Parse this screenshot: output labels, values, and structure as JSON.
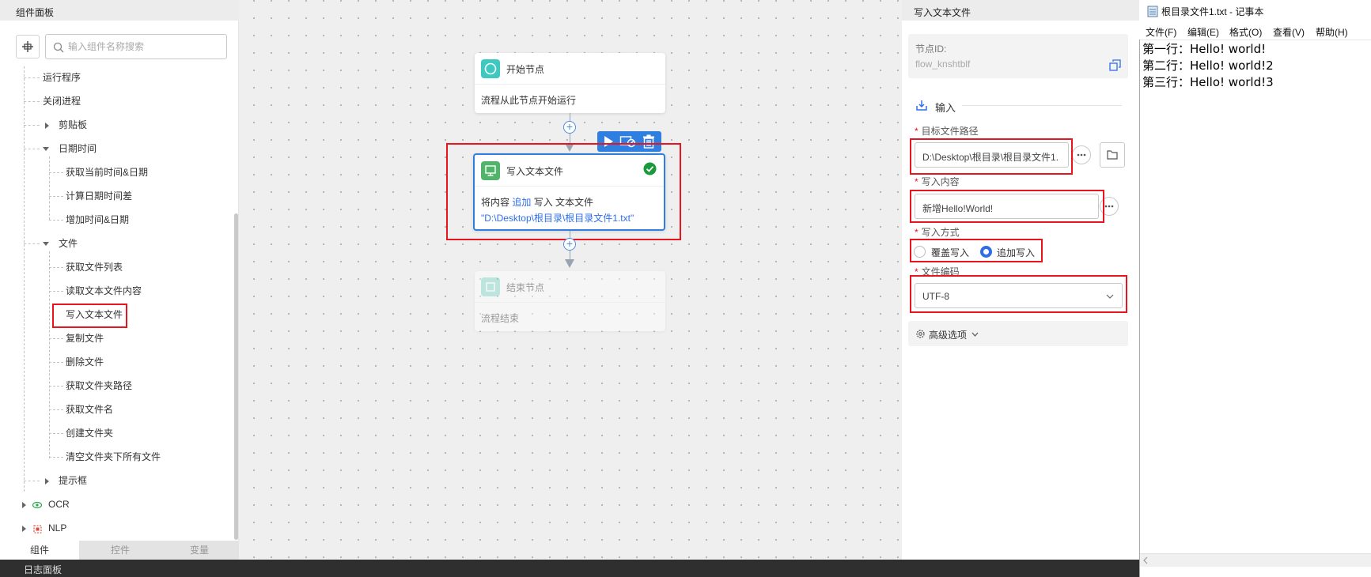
{
  "left_panel": {
    "title": "组件面板",
    "search_placeholder": "输入组件名称搜索",
    "tree": {
      "run_program": "运行程序",
      "close_process": "关闭进程",
      "clipboard": "剪贴板",
      "datetime": "日期时间",
      "get_current_datetime": "获取当前时间&日期",
      "calc_date_diff": "计算日期时间差",
      "add_datetime": "增加时间&日期",
      "file": "文件",
      "get_file_list": "获取文件列表",
      "read_text_file": "读取文本文件内容",
      "write_text_file": "写入文本文件",
      "copy_file": "复制文件",
      "delete_file": "删除文件",
      "get_folder_path": "获取文件夹路径",
      "get_file_name": "获取文件名",
      "create_folder": "创建文件夹",
      "clear_folder": "清空文件夹下所有文件",
      "prompt_box": "提示框",
      "ocr": "OCR",
      "nlp": "NLP"
    },
    "tabs": {
      "components": "组件",
      "controls": "控件",
      "variables": "变量"
    }
  },
  "canvas": {
    "start_node": {
      "title": "开始节点",
      "desc": "流程从此节点开始运行"
    },
    "write_node": {
      "title": "写入文本文件",
      "desc_prefix": "将内容",
      "desc_mode": "追加",
      "desc_mid": "写入 文本文件",
      "desc_path": "\"D:\\Desktop\\根目录\\根目录文件1.txt\""
    },
    "end_node": {
      "title": "结束节点",
      "desc": "流程结束"
    }
  },
  "properties": {
    "title": "写入文本文件",
    "node_id_label": "节点ID:",
    "node_id_value": "flow_knshtblf",
    "input_section": "输入",
    "target_path_label": "目标文件路径",
    "target_path_value": "D:\\Desktop\\根目录\\根目录文件1.",
    "content_label": "写入内容",
    "content_value": "新增Hello!World!",
    "mode_label": "写入方式",
    "mode_overwrite": "覆盖写入",
    "mode_append": "追加写入",
    "mode_selected": "追加写入",
    "encoding_label": "文件编码",
    "encoding_value": "UTF-8",
    "advanced": "高级选项"
  },
  "notepad": {
    "title": "根目录文件1.txt - 记事本",
    "menu": [
      "文件(F)",
      "编辑(E)",
      "格式(O)",
      "查看(V)",
      "帮助(H)"
    ],
    "lines": [
      "第一行：Hello! world!",
      "第二行：Hello! world!2",
      "第三行：Hello! world!3"
    ]
  },
  "log_panel": {
    "title": "日志面板"
  },
  "colors": {
    "accent_blue": "#2f6ee8",
    "highlight_red": "#e8141e",
    "start_icon": "#3ec9c0",
    "write_icon": "#52b36a",
    "success_green": "#1a9a3a"
  }
}
